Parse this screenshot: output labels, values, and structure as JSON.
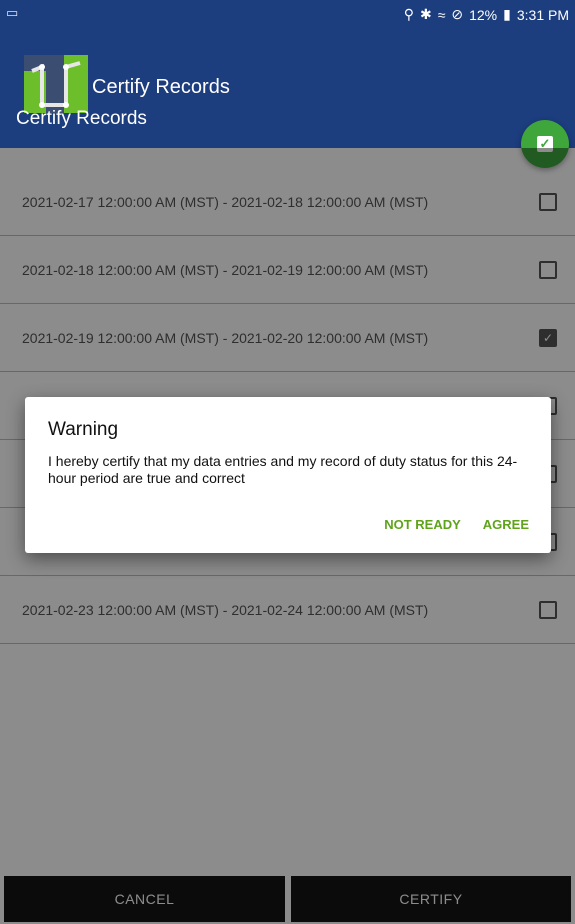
{
  "status_bar": {
    "battery": "12%",
    "time": "3:31 PM",
    "left_icon": "screenshot-icon",
    "icons": [
      "location-icon",
      "bluetooth-icon",
      "wifi-icon",
      "do-not-disturb-icon",
      "battery-icon"
    ]
  },
  "app_bar": {
    "brand_name": "Certify Records",
    "page_title": "Certify Records",
    "background_color": "#1c3d7e",
    "fab_icon": "check-box-icon",
    "fab_color": "#3fa63c"
  },
  "records": [
    {
      "label": "2021-02-17 12:00:00 AM (MST) - 2021-02-18 12:00:00 AM (MST)",
      "checked": false
    },
    {
      "label": "2021-02-18 12:00:00 AM (MST) - 2021-02-19 12:00:00 AM (MST)",
      "checked": false
    },
    {
      "label": "2021-02-19 12:00:00 AM (MST) - 2021-02-20 12:00:00 AM (MST)",
      "checked": true
    },
    {
      "label": "",
      "checked": false
    },
    {
      "label": "",
      "checked": false
    },
    {
      "label": "",
      "checked": false
    },
    {
      "label": "2021-02-23 12:00:00 AM (MST) - 2021-02-24 12:00:00 AM (MST)",
      "checked": false
    }
  ],
  "dialog": {
    "title": "Warning",
    "message": "I hereby certify that my data entries and my record of duty status for this 24-hour period are true and correct",
    "not_ready_label": "NOT READY",
    "agree_label": "AGREE",
    "action_color": "#5fa31a"
  },
  "bottom_bar": {
    "cancel_label": "CANCEL",
    "certify_label": "CERTIFY"
  }
}
